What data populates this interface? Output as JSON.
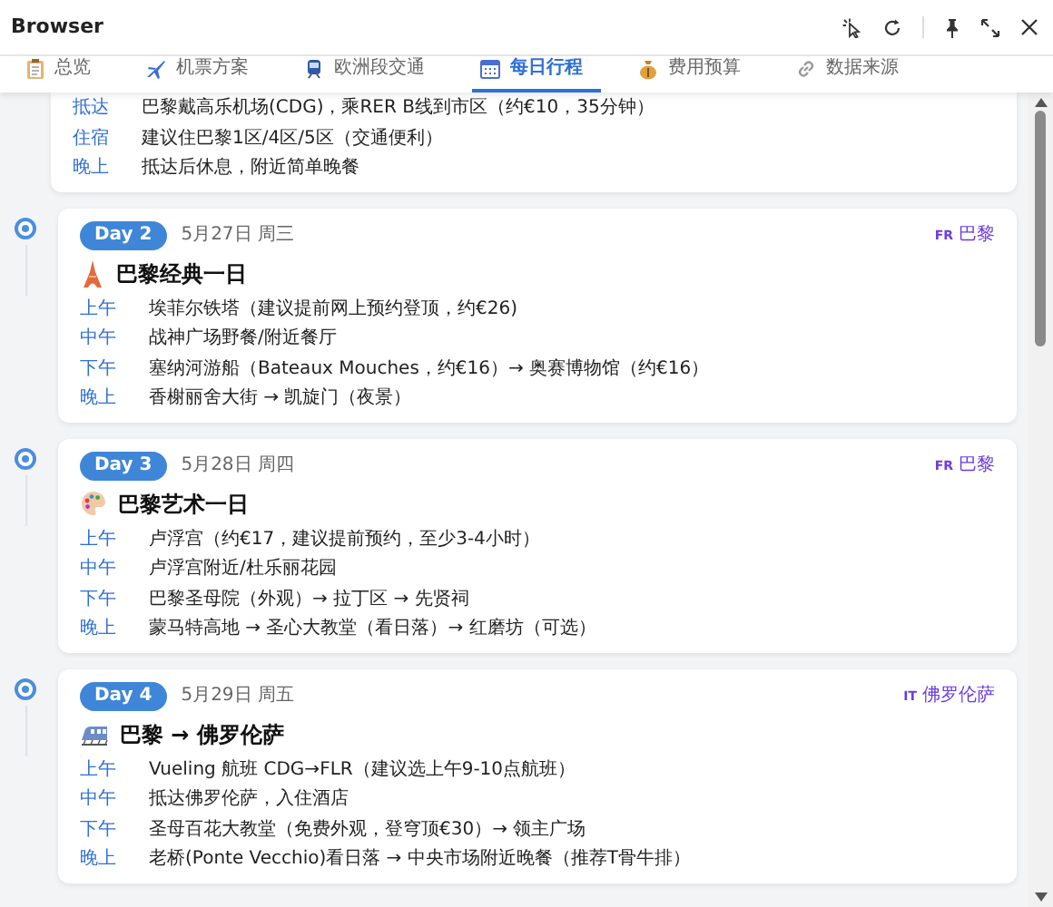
{
  "window": {
    "title": "Browser"
  },
  "tabs": [
    {
      "label": "总览",
      "selected": false
    },
    {
      "label": "机票方案",
      "selected": false
    },
    {
      "label": "欧洲段交通",
      "selected": false
    },
    {
      "label": "每日行程",
      "selected": true
    },
    {
      "label": "费用预算",
      "selected": false
    },
    {
      "label": "数据来源",
      "selected": false
    }
  ],
  "partial_card": {
    "rows": [
      {
        "time": "抵达",
        "text": "巴黎戴高乐机场(CDG)，乘RER B线到市区（约€10，35分钟）"
      },
      {
        "time": "住宿",
        "text": "建议住巴黎1区/4区/5区（交通便利）"
      },
      {
        "time": "晚上",
        "text": "抵达后休息，附近简单晚餐"
      }
    ]
  },
  "days": [
    {
      "badge": "Day 2",
      "date": "5月27日 周三",
      "flag": "FR",
      "city": "巴黎",
      "title": "巴黎经典一日",
      "rows": [
        {
          "time": "上午",
          "text": "埃菲尔铁塔（建议提前网上预约登顶，约€26)"
        },
        {
          "time": "中午",
          "text": "战神广场野餐/附近餐厅"
        },
        {
          "time": "下午",
          "text": "塞纳河游船（Bateaux Mouches，约€16）→ 奥赛博物馆（约€16）"
        },
        {
          "time": "晚上",
          "text": "香榭丽舍大街 → 凯旋门（夜景）"
        }
      ]
    },
    {
      "badge": "Day 3",
      "date": "5月28日 周四",
      "flag": "FR",
      "city": "巴黎",
      "title": "巴黎艺术一日",
      "rows": [
        {
          "time": "上午",
          "text": "卢浮宫（约€17，建议提前预约，至少3-4小时）"
        },
        {
          "time": "中午",
          "text": "卢浮宫附近/杜乐丽花园"
        },
        {
          "time": "下午",
          "text": "巴黎圣母院（外观）→ 拉丁区 → 先贤祠"
        },
        {
          "time": "晚上",
          "text": "蒙马特高地 → 圣心大教堂（看日落）→ 红磨坊（可选）"
        }
      ]
    },
    {
      "badge": "Day 4",
      "date": "5月29日 周五",
      "flag": "IT",
      "city": "佛罗伦萨",
      "title": "巴黎 → 佛罗伦萨",
      "rows": [
        {
          "time": "上午",
          "text": "Vueling 航班 CDG→FLR（建议选上午9-10点航班）"
        },
        {
          "time": "中午",
          "text": "抵达佛罗伦萨，入住酒店"
        },
        {
          "time": "下午",
          "text": "圣母百花大教堂（免费外观，登穹顶€30）→ 领主广场"
        },
        {
          "time": "晚上",
          "text": "老桥(Ponte Vecchio)看日落 → 中央市场附近晚餐（推荐T骨牛排）"
        }
      ]
    }
  ]
}
